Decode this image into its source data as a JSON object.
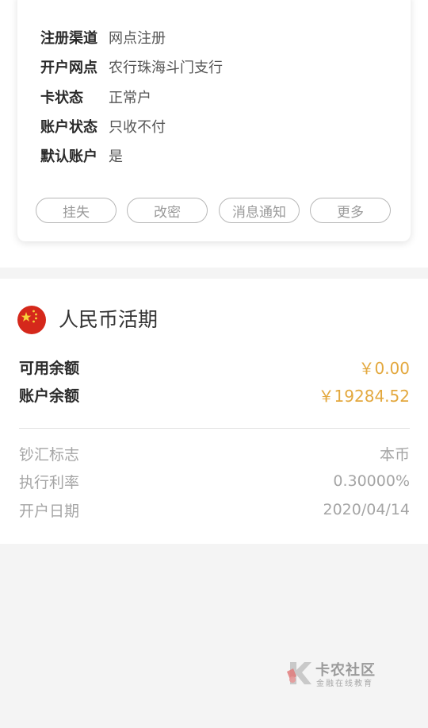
{
  "card": {
    "rows": [
      {
        "label": "注册渠道",
        "value": "网点注册"
      },
      {
        "label": "开户网点",
        "value": "农行珠海斗门支行"
      },
      {
        "label": "卡状态",
        "value": "正常户"
      },
      {
        "label": "账户状态",
        "value": "只收不付"
      },
      {
        "label": "默认账户",
        "value": "是"
      }
    ],
    "buttons": [
      "挂失",
      "改密",
      "消息通知",
      "更多"
    ]
  },
  "account": {
    "title": "人民币活期",
    "available_label": "可用余额",
    "available_value": "￥0.00",
    "balance_label": "账户余额",
    "balance_value": "￥19284.52",
    "meta": [
      {
        "label": "钞汇标志",
        "value": "本币"
      },
      {
        "label": "执行利率",
        "value": "0.30000%"
      },
      {
        "label": "开户日期",
        "value": "2020/04/14"
      }
    ]
  },
  "watermark": {
    "title": "卡农社区",
    "subtitle": "金融在线教育"
  },
  "colors": {
    "accent": "#e3a83e",
    "flag_red": "#d5281b",
    "flag_star": "#f7d23b"
  }
}
